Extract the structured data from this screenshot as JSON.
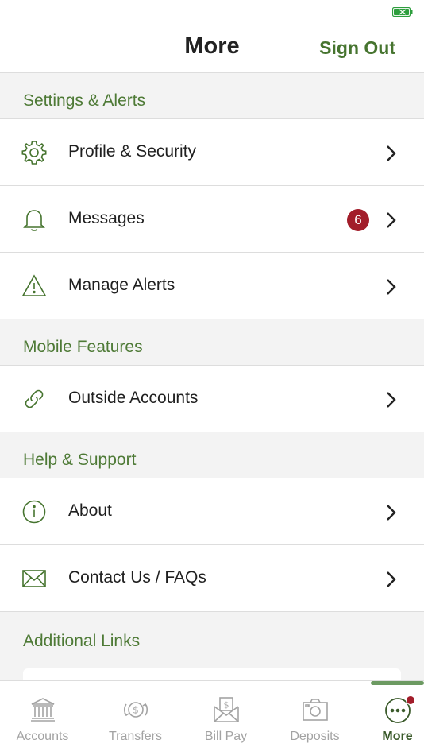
{
  "header": {
    "title": "More",
    "sign_out": "Sign Out"
  },
  "sections": {
    "settings": {
      "title": "Settings & Alerts",
      "items": [
        {
          "label": "Profile & Security",
          "icon": "gear-icon"
        },
        {
          "label": "Messages",
          "icon": "bell-icon",
          "badge": "6"
        },
        {
          "label": "Manage Alerts",
          "icon": "warning-icon"
        }
      ]
    },
    "mobile": {
      "title": "Mobile Features",
      "items": [
        {
          "label": "Outside Accounts",
          "icon": "link-icon"
        }
      ]
    },
    "help": {
      "title": "Help & Support",
      "items": [
        {
          "label": "About",
          "icon": "info-icon"
        },
        {
          "label": "Contact Us / FAQs",
          "icon": "envelope-icon"
        }
      ]
    },
    "links": {
      "title": "Additional Links"
    }
  },
  "tabs": [
    {
      "label": "Accounts",
      "icon": "bank-icon",
      "active": false
    },
    {
      "label": "Transfers",
      "icon": "transfer-icon",
      "active": false
    },
    {
      "label": "Bill Pay",
      "icon": "bill-pay-icon",
      "active": false
    },
    {
      "label": "Deposits",
      "icon": "camera-icon",
      "active": false
    },
    {
      "label": "More",
      "icon": "more-icon",
      "active": true
    }
  ],
  "colors": {
    "accent": "#46742f",
    "badge": "#a21d2a",
    "inactive_tab": "#a3a3a3"
  }
}
